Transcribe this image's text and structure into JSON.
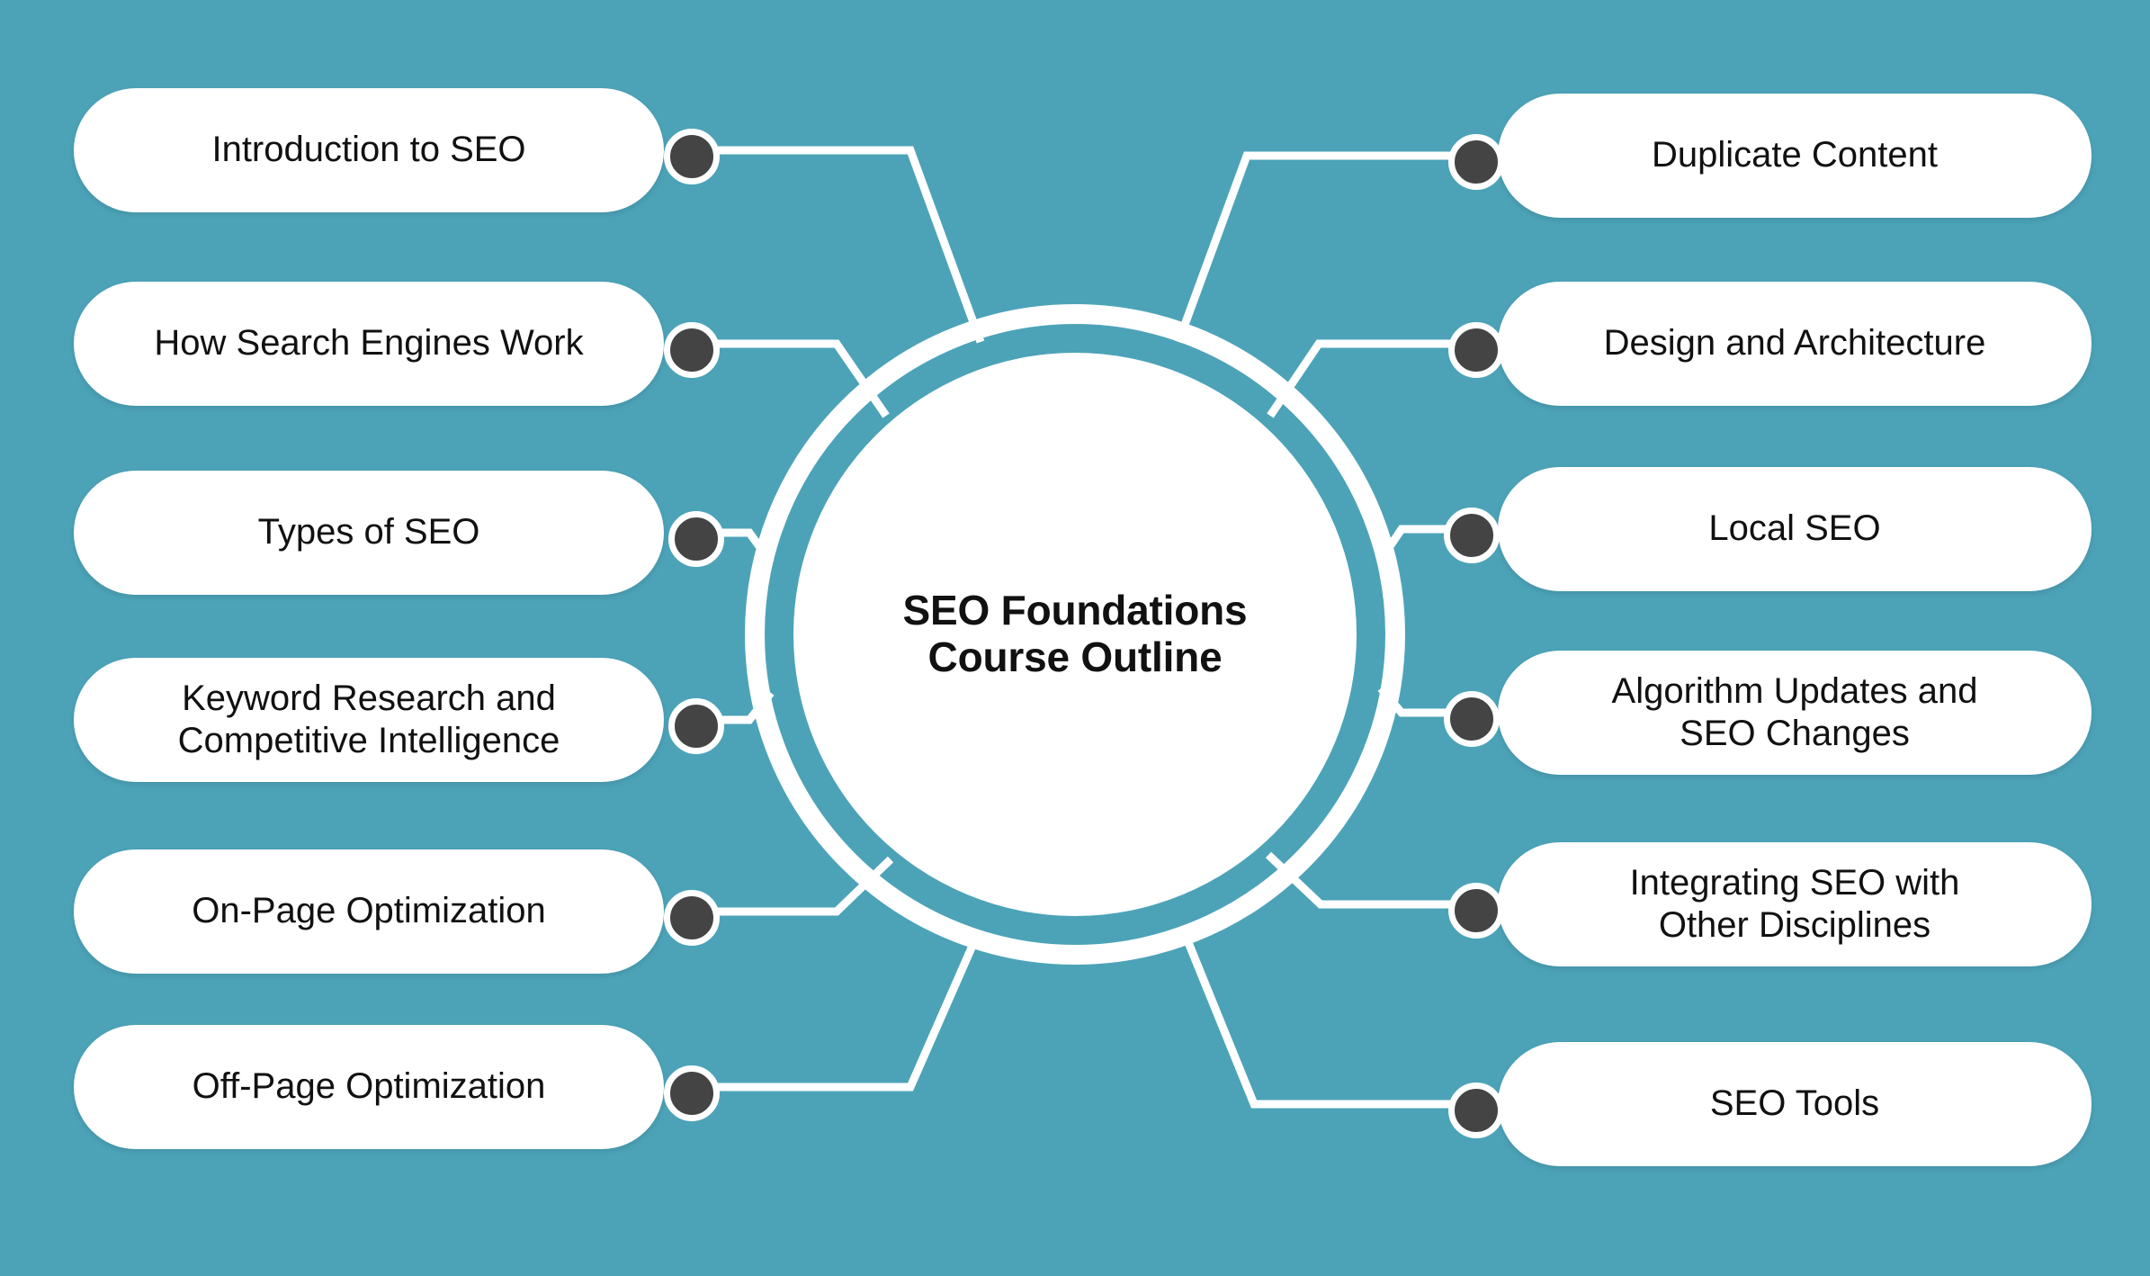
{
  "theme": {
    "background_color": "#4ca3b8",
    "node_fill": "#ffffff",
    "node_text_color": "#111111",
    "connector_dot_color": "#444444",
    "connector_line_color": "#ffffff"
  },
  "center": {
    "title_line_1": "SEO Foundations",
    "title_line_2": "Course Outline"
  },
  "branches": {
    "left": [
      {
        "id": "introduction-to-seo",
        "label": "Introduction to SEO"
      },
      {
        "id": "how-search-engines-work",
        "label": "How Search Engines Work"
      },
      {
        "id": "types-of-seo",
        "label": "Types of SEO"
      },
      {
        "id": "keyword-research-and-competitive-intelligence",
        "label": "Keyword Research and\nCompetitive Intelligence"
      },
      {
        "id": "on-page-optimization",
        "label": "On-Page Optimization"
      },
      {
        "id": "off-page-optimization",
        "label": "Off-Page Optimization"
      }
    ],
    "right": [
      {
        "id": "duplicate-content",
        "label": "Duplicate Content"
      },
      {
        "id": "design-and-architecture",
        "label": "Design and Architecture"
      },
      {
        "id": "local-seo",
        "label": "Local SEO"
      },
      {
        "id": "algorithm-updates-and-seo-changes",
        "label": "Algorithm Updates and\nSEO Changes"
      },
      {
        "id": "integrating-seo-with-other-disciplines",
        "label": "Integrating SEO with\nOther Disciplines"
      },
      {
        "id": "seo-tools",
        "label": "SEO Tools"
      }
    ]
  },
  "chart_data": {
    "type": "diagram",
    "diagram_type": "mind-map",
    "title": "SEO Foundations Course Outline",
    "center_node": "SEO Foundations Course Outline",
    "branch_count": 12,
    "nodes": [
      "Introduction to SEO",
      "How Search Engines Work",
      "Types of SEO",
      "Keyword Research and Competitive Intelligence",
      "On-Page Optimization",
      "Off-Page Optimization",
      "Duplicate Content",
      "Design and Architecture",
      "Local SEO",
      "Algorithm Updates and SEO Changes",
      "Integrating SEO with Other Disciplines",
      "SEO Tools"
    ]
  }
}
